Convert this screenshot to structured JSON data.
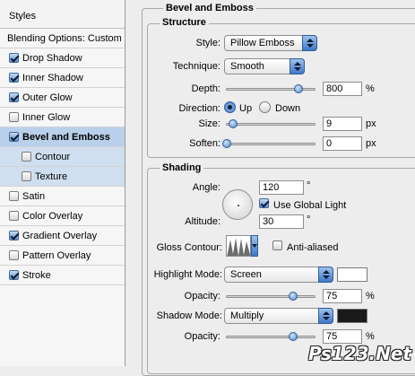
{
  "sidebar": {
    "header": "Styles",
    "blending_options": "Blending Options: Custom",
    "items": [
      {
        "label": "Drop Shadow",
        "checked": true
      },
      {
        "label": "Inner Shadow",
        "checked": true
      },
      {
        "label": "Outer Glow",
        "checked": true
      },
      {
        "label": "Inner Glow",
        "checked": false
      },
      {
        "label": "Bevel and Emboss",
        "checked": true,
        "selected": true
      },
      {
        "label": "Contour",
        "checked": false,
        "sub": true
      },
      {
        "label": "Texture",
        "checked": false,
        "sub": true
      },
      {
        "label": "Satin",
        "checked": false
      },
      {
        "label": "Color Overlay",
        "checked": false
      },
      {
        "label": "Gradient Overlay",
        "checked": true
      },
      {
        "label": "Pattern Overlay",
        "checked": false
      },
      {
        "label": "Stroke",
        "checked": true
      }
    ]
  },
  "panel": {
    "title": "Bevel and Emboss",
    "structure": {
      "title": "Structure",
      "style_label": "Style:",
      "style_value": "Pillow Emboss",
      "technique_label": "Technique:",
      "technique_value": "Smooth",
      "depth_label": "Depth:",
      "depth_value": "800",
      "depth_unit": "%",
      "depth_slider": 0.82,
      "direction_label": "Direction:",
      "direction_up": "Up",
      "direction_down": "Down",
      "direction_selected": "Up",
      "size_label": "Size:",
      "size_value": "9",
      "size_unit": "px",
      "size_slider": 0.07,
      "soften_label": "Soften:",
      "soften_value": "0",
      "soften_unit": "px",
      "soften_slider": 0.0
    },
    "shading": {
      "title": "Shading",
      "angle_label": "Angle:",
      "angle_value": "120",
      "degree": "°",
      "global_light_label": "Use Global Light",
      "global_light_checked": true,
      "altitude_label": "Altitude:",
      "altitude_value": "30",
      "gloss_contour_label": "Gloss Contour:",
      "anti_aliased_label": "Anti-aliased",
      "anti_aliased_checked": false,
      "highlight_mode_label": "Highlight Mode:",
      "highlight_mode_value": "Screen",
      "highlight_color": "#ffffff",
      "highlight_opacity_label": "Opacity:",
      "highlight_opacity_value": "75",
      "highlight_opacity_unit": "%",
      "highlight_opacity_slider": 0.75,
      "shadow_mode_label": "Shadow Mode:",
      "shadow_mode_value": "Multiply",
      "shadow_color": "#1a1a1a",
      "shadow_opacity_label": "Opacity:",
      "shadow_opacity_value": "75",
      "shadow_opacity_unit": "%",
      "shadow_opacity_slider": 0.75
    }
  },
  "watermark": "Ps123.Net"
}
